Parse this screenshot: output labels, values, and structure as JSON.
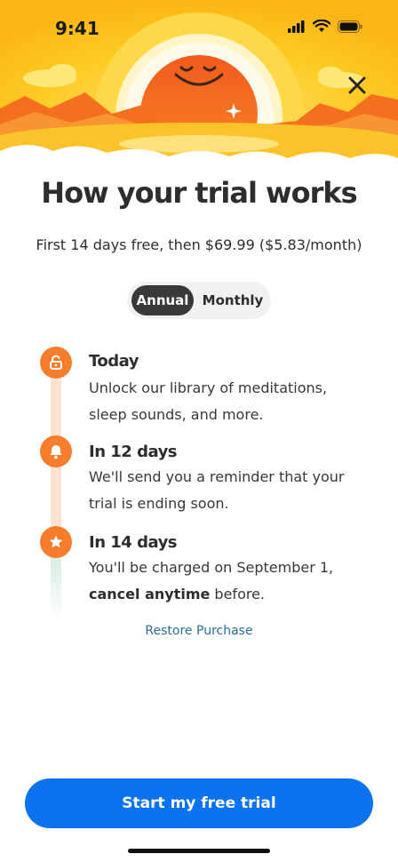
{
  "status_bar": {
    "time": "9:41"
  },
  "header": {
    "title": "How your trial works",
    "subtitle": "First 14 days free, then $69.99 ($5.83/month)"
  },
  "plan_toggle": {
    "options": [
      "Annual",
      "Monthly"
    ],
    "selected": "Annual"
  },
  "steps": [
    {
      "icon": "unlock-icon",
      "title": "Today",
      "desc_line1": "Unlock our library of meditations,",
      "desc_line2": "sleep sounds, and more."
    },
    {
      "icon": "bell-icon",
      "title": "In 12 days",
      "desc_line1": "We'll send you a reminder that your",
      "desc_line2": "trial is ending soon."
    },
    {
      "icon": "star-icon",
      "title": "In 14 days",
      "desc_line1": "You'll be charged on September 1,",
      "desc_bold": "cancel anytime",
      "desc_after_bold": " before."
    }
  ],
  "restore_label": "Restore Purchase",
  "cta_label": "Start my free trial",
  "colors": {
    "accent_orange": "#f57d2b",
    "sun_orange": "#f4691f",
    "sky_yellow": "#fbc21a",
    "cta_blue": "#0b72f0",
    "link_blue": "#2a6f95"
  }
}
